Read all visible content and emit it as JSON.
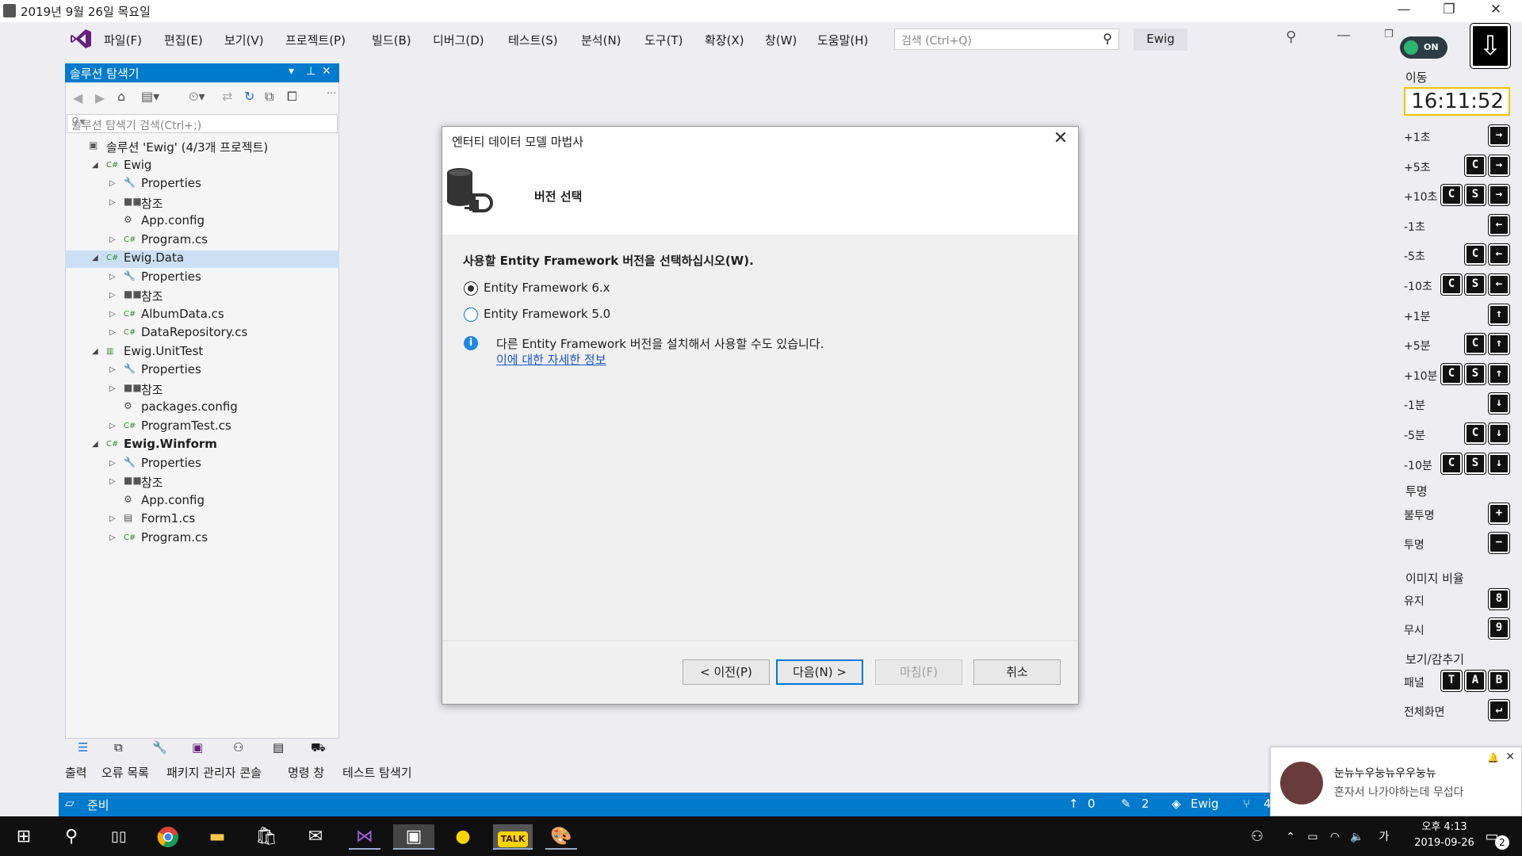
{
  "titlebar": {
    "date": "2019년 9월 26일 목요일",
    "minimize": "—",
    "restore": "❐",
    "close": "✕"
  },
  "menu": {
    "items": [
      "파일(F)",
      "편집(E)",
      "보기(V)",
      "프로젝트(P)",
      "빌드(B)",
      "디버그(D)",
      "테스트(S)",
      "분석(N)",
      "도구(T)",
      "확장(X)",
      "창(W)",
      "도움말(H)"
    ],
    "search_placeholder": "검색 (Ctrl+Q)",
    "solution_name": "Ewig"
  },
  "solution_explorer": {
    "title": "솔루션 탐색기",
    "search_placeholder": "솔루션 탐색기 검색(Ctrl+;)",
    "tree": [
      {
        "label": "솔루션 'Ewig' (4/3개 프로젝트)",
        "icon": "solution-icon"
      },
      {
        "label": "Ewig",
        "icon": "csharp-project-icon"
      },
      {
        "label": "Properties",
        "icon": "wrench-icon"
      },
      {
        "label": "참조",
        "icon": "references-icon"
      },
      {
        "label": "App.config",
        "icon": "config-file-icon"
      },
      {
        "label": "Program.cs",
        "icon": "csharp-file-icon"
      },
      {
        "label": "Ewig.Data",
        "icon": "csharp-project-icon"
      },
      {
        "label": "Properties",
        "icon": "wrench-icon"
      },
      {
        "label": "참조",
        "icon": "references-icon"
      },
      {
        "label": "AlbumData.cs",
        "icon": "csharp-file-icon"
      },
      {
        "label": "DataRepository.cs",
        "icon": "csharp-file-icon"
      },
      {
        "label": "Ewig.UnitTest",
        "icon": "test-project-icon"
      },
      {
        "label": "Properties",
        "icon": "wrench-icon"
      },
      {
        "label": "참조",
        "icon": "references-icon"
      },
      {
        "label": "packages.config",
        "icon": "config-file-icon"
      },
      {
        "label": "ProgramTest.cs",
        "icon": "csharp-file-icon"
      },
      {
        "label": "Ewig.Winform",
        "icon": "csharp-project-icon"
      },
      {
        "label": "Properties",
        "icon": "wrench-icon"
      },
      {
        "label": "참조",
        "icon": "references-icon"
      },
      {
        "label": "App.config",
        "icon": "config-file-icon"
      },
      {
        "label": "Form1.cs",
        "icon": "form-file-icon"
      },
      {
        "label": "Program.cs",
        "icon": "csharp-file-icon"
      }
    ]
  },
  "bottom_tabs": [
    "출력",
    "오류 목록",
    "패키지 관리자 콘솔",
    "명령 창",
    "테스트 탐색기"
  ],
  "dialog": {
    "title": "엔터티 데이터 모델 마법사",
    "step": "버전 선택",
    "question": "사용할 Entity Framework 버전을 선택하십시오(W).",
    "options": [
      "Entity Framework 6.x",
      "Entity Framework 5.0"
    ],
    "selected_option": "Entity Framework 6.x",
    "info_text": "다른 Entity Framework 버전을 설치해서 사용할 수도 있습니다.",
    "info_link": "이에 대한 자세한 정보",
    "buttons": {
      "back": "< 이전(P)",
      "next": "다음(N) >",
      "finish": "마침(F)",
      "cancel": "취소"
    }
  },
  "right_panel": {
    "toggle": "ON",
    "move_title": "이동",
    "clock": "16:11:52",
    "move_rows": [
      {
        "label": "+1초",
        "keys": [
          "→"
        ]
      },
      {
        "label": "+5초",
        "keys": [
          "C",
          "→"
        ]
      },
      {
        "label": "+10초",
        "keys": [
          "C",
          "S",
          "→"
        ]
      },
      {
        "label": "-1초",
        "keys": [
          "←"
        ]
      },
      {
        "label": "-5초",
        "keys": [
          "C",
          "←"
        ]
      },
      {
        "label": "-10초",
        "keys": [
          "C",
          "S",
          "←"
        ]
      },
      {
        "label": "+1분",
        "keys": [
          "↑"
        ]
      },
      {
        "label": "+5분",
        "keys": [
          "C",
          "↑"
        ]
      },
      {
        "label": "+10분",
        "keys": [
          "C",
          "S",
          "↑"
        ]
      },
      {
        "label": "-1분",
        "keys": [
          "↓"
        ]
      },
      {
        "label": "-5분",
        "keys": [
          "C",
          "↓"
        ]
      },
      {
        "label": "-10분",
        "keys": [
          "C",
          "S",
          "↓"
        ]
      }
    ],
    "opacity_title": "투명",
    "opacity_rows": [
      {
        "label": "불투명",
        "keys": [
          "+"
        ]
      },
      {
        "label": "투명",
        "keys": [
          "−"
        ]
      }
    ],
    "ratio_title": "이미지 비율",
    "ratio_rows": [
      {
        "label": "유지",
        "keys": [
          "8"
        ]
      },
      {
        "label": "무시",
        "keys": [
          "9"
        ]
      }
    ],
    "view_title": "보기/감추기",
    "view_rows": [
      {
        "label": "패널",
        "keys": [
          "T",
          "A",
          "B"
        ]
      },
      {
        "label": "전체화면",
        "keys": [
          "↵"
        ]
      }
    ]
  },
  "statusbar": {
    "state": "준비",
    "up_count": "0",
    "edit_count": "2",
    "repo": "Ewig",
    "branch_count": "4"
  },
  "notification": {
    "line1": "눈뉴누우눙뉴우우눙뉴",
    "line2": "혼자서 나가야하는데 무섭다"
  },
  "taskbar": {
    "time": "오후 4:13",
    "date": "2019-09-26",
    "ime": "가",
    "badge": "2"
  }
}
